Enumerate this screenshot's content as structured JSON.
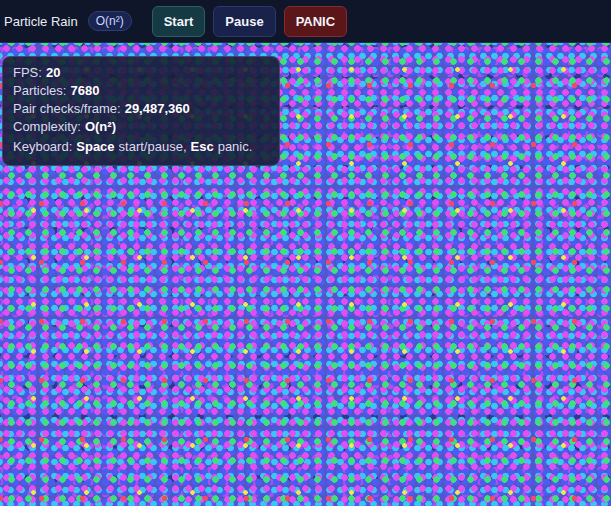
{
  "title": "Particle Rain",
  "badge": "O(n²)",
  "buttons": [
    {
      "label": "Start",
      "kind": "start"
    },
    {
      "label": "Pause",
      "kind": "pause"
    },
    {
      "label": "PANIC",
      "kind": "panic"
    }
  ],
  "stats": [
    {
      "label": "FPS:",
      "value": "20"
    },
    {
      "label": "Particles:",
      "value": "7680"
    },
    {
      "label": "Pair checks/frame:",
      "value": "29,487,360"
    },
    {
      "label": "Complexity:",
      "value": "O(n²)"
    }
  ],
  "keyboard": [
    {
      "text": "Keyboard:",
      "bold": true
    },
    {
      "text": "Space",
      "bold": true
    },
    {
      "text": "start/pause,",
      "bold": false
    },
    {
      "text": "Esc",
      "bold": true
    },
    {
      "text": "panic.",
      "bold": false
    }
  ]
}
